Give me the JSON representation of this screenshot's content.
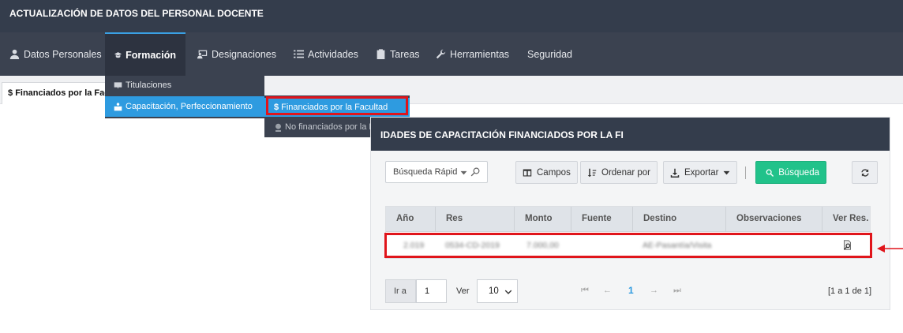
{
  "app": {
    "title": "ACTUALIZACIÓN DE DATOS DEL PERSONAL DOCENTE"
  },
  "nav": {
    "items": [
      {
        "label": "Datos Personales",
        "icon": "user-icon"
      },
      {
        "label": "Formación",
        "icon": "graduation-cap-icon",
        "active": true
      },
      {
        "label": "Designaciones",
        "icon": "chalkboard-icon"
      },
      {
        "label": "Actividades",
        "icon": "list-icon"
      },
      {
        "label": "Tareas",
        "icon": "clipboard-icon"
      },
      {
        "label": "Herramientas",
        "icon": "wrench-icon"
      },
      {
        "label": "Seguridad",
        "icon": ""
      }
    ]
  },
  "dropdown": {
    "items": [
      {
        "label": "Titulaciones",
        "icon": "certificate-icon"
      },
      {
        "label": "Capacitación, Perfeccionamiento",
        "icon": "training-icon",
        "selected": true
      }
    ]
  },
  "submenu": {
    "items": [
      {
        "label": "Financiados por la Facultad",
        "icon": "dollar-icon",
        "selected": true
      },
      {
        "label": "No financiados por la Facultad",
        "icon": "badge-icon"
      }
    ]
  },
  "tab": {
    "label": "Financiados por la Facultad",
    "prefix": "$"
  },
  "panel": {
    "title": "IDADES DE CAPACITACIÓN FINANCIADOS POR LA FI",
    "search_placeholder": "Búsqueda Rápid",
    "buttons": {
      "campos": "Campos",
      "ordenar": "Ordenar por",
      "exportar": "Exportar",
      "busqueda": "Búsqueda"
    }
  },
  "table": {
    "columns": [
      "Año",
      "Res",
      "Monto",
      "Fuente",
      "Destino",
      "Observaciones",
      "Ver Res."
    ],
    "rows": [
      {
        "anio": "2.019",
        "res": "0534-CD-2019",
        "monto": "7.000,00",
        "fuente": "",
        "destino": "AE-Pasantía/Visita",
        "observaciones": "",
        "ver_res_icon": "view-document-icon"
      }
    ]
  },
  "pager": {
    "ira_label": "Ir a",
    "page_value": "1",
    "ver_label": "Ver",
    "page_size": "10",
    "current_page": "1",
    "info": "[1 a 1 de 1]"
  },
  "colors": {
    "topbar": "#343d4c",
    "navbar": "#3b4250",
    "accent": "#2e9be0",
    "search_button": "#21c28a",
    "highlight": "#e0151b"
  }
}
